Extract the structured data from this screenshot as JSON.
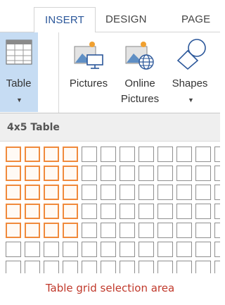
{
  "tabs": [
    {
      "label": "INSERT",
      "active": true
    },
    {
      "label": "DESIGN",
      "active": false
    },
    {
      "label": "PAGE",
      "active": false
    }
  ],
  "ribbon": {
    "table_button": {
      "label": "Table",
      "icon": "table-icon",
      "selected": true
    },
    "pictures_button": {
      "label": "Pictures",
      "icon": "pictures-icon"
    },
    "online_pictures_button": {
      "label_line1": "Online",
      "label_line2": "Pictures",
      "icon": "online-pictures-icon"
    },
    "shapes_button": {
      "label": "Shapes",
      "icon": "shapes-icon"
    }
  },
  "dropdown": {
    "title": "4x5 Table",
    "grid": {
      "selected_columns": 4,
      "selected_rows": 5
    }
  },
  "caption": "Table grid selection area",
  "colors": {
    "accent_blue": "#2b579a",
    "selection_orange": "#f08a3c",
    "selected_button_bg": "#c6dcf3",
    "caption_red": "#c0392b"
  }
}
